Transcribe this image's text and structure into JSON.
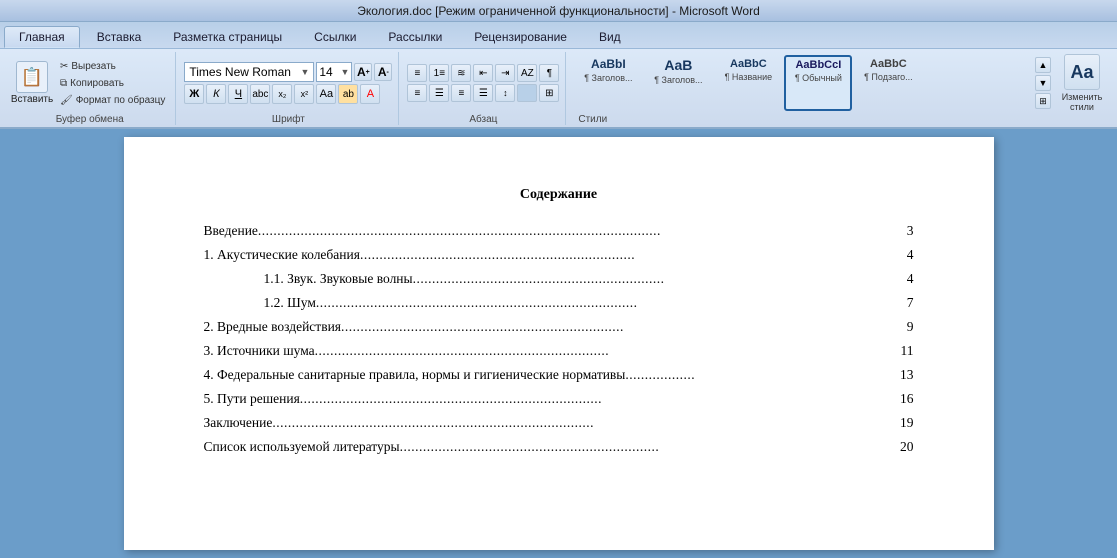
{
  "title_bar": {
    "text": "Экология.doc [Режим ограниченной функциональности] - Microsoft Word"
  },
  "tabs": [
    {
      "label": "Главная",
      "active": true
    },
    {
      "label": "Вставка",
      "active": false
    },
    {
      "label": "Разметка страницы",
      "active": false
    },
    {
      "label": "Ссылки",
      "active": false
    },
    {
      "label": "Рассылки",
      "active": false
    },
    {
      "label": "Рецензирование",
      "active": false
    },
    {
      "label": "Вид",
      "active": false
    }
  ],
  "ribbon": {
    "paste_label": "Вставить",
    "cut_label": "Вырезать",
    "copy_label": "Копировать",
    "format_label": "Формат по образцу",
    "clipboard_label": "Буфер обмена",
    "font_name": "Times New Roman",
    "font_size": "14",
    "font_label": "Шрифт",
    "bold": "Ж",
    "italic": "К",
    "underline": "Ч",
    "para_label": "Абзац",
    "styles_label": "Стили",
    "styles": [
      {
        "name": "AaBbI",
        "label": "¶ Заголов...",
        "active": false
      },
      {
        "name": "AaB",
        "label": "¶ Заголов...",
        "active": false
      },
      {
        "name": "AaBbC",
        "label": "¶ Название",
        "active": false
      },
      {
        "name": "AaBbCcI",
        "label": "¶ Обычный",
        "active": true
      },
      {
        "name": "AaBbC",
        "label": "¶ Подзаго...",
        "active": false
      }
    ],
    "change_styles_label": "Изменить стили"
  },
  "document": {
    "toc_title": "Содержание",
    "toc_entries": [
      {
        "text": "Введение",
        "dots": "........................................................................................................",
        "page": "3",
        "indent": 0
      },
      {
        "text": "1. Акустические колебания",
        "dots": ".......................................................................",
        "page": "4",
        "indent": 0
      },
      {
        "text": "1.1. Звук. Звуковые волны",
        "dots": ".................................................................",
        "page": "4",
        "indent": 1
      },
      {
        "text": "1.2. Шум",
        "dots": "...................................................................................",
        "page": "7",
        "indent": 1
      },
      {
        "text": "2. Вредные воздействия",
        "dots": ".........................................................................",
        "page": "9",
        "indent": 0
      },
      {
        "text": "3. Источники шума",
        "dots": "............................................................................",
        "page": "11",
        "indent": 0
      },
      {
        "text": "4. Федеральные санитарные правила, нормы и гигиенические нормативы",
        "dots": "..................",
        "page": "13",
        "indent": 0
      },
      {
        "text": "5. Пути решения",
        "dots": "..............................................................................",
        "page": "16",
        "indent": 0
      },
      {
        "text": "Заключение",
        "dots": "...................................................................................",
        "page": "19",
        "indent": 0
      },
      {
        "text": "Список используемой литературы",
        "dots": "...................................................................",
        "page": "20",
        "indent": 0
      }
    ]
  }
}
